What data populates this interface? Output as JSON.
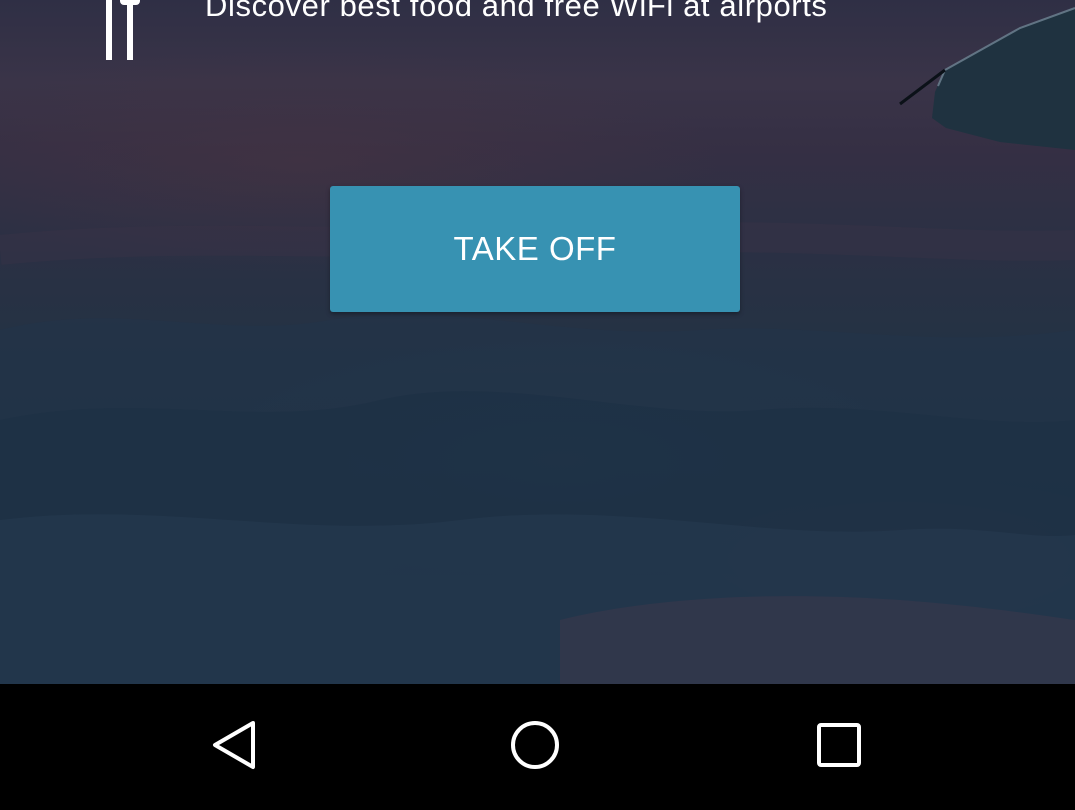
{
  "feature": {
    "icon": "fork-knife-icon",
    "text": "Discover best food and free WiFi at airports"
  },
  "actions": {
    "take_off_label": "TAKE OFF"
  },
  "navbar": {
    "back_icon": "back-triangle-icon",
    "home_icon": "home-circle-icon",
    "recents_icon": "recents-square-icon"
  },
  "colors": {
    "button_bg": "#3792b2",
    "text": "#ffffff",
    "navbar_bg": "#000000"
  }
}
